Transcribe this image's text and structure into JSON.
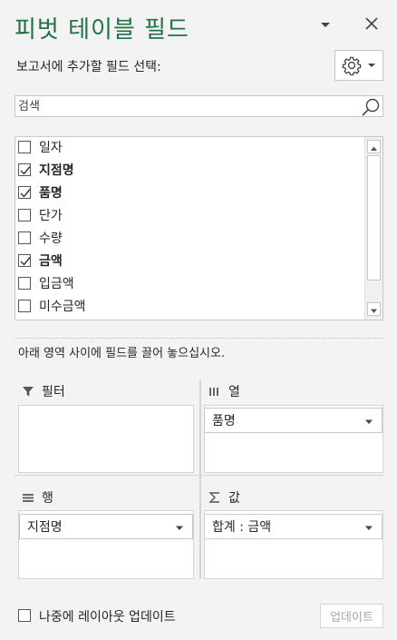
{
  "pane": {
    "title": "피벗 테이블 필드",
    "choose_fields_label": "보고서에 추가할 필드 선택:"
  },
  "search": {
    "placeholder": "검색",
    "value": ""
  },
  "fields": [
    {
      "label": "일자",
      "checked": false
    },
    {
      "label": "지점명",
      "checked": true
    },
    {
      "label": "품명",
      "checked": true
    },
    {
      "label": "단가",
      "checked": false
    },
    {
      "label": "수량",
      "checked": false
    },
    {
      "label": "금액",
      "checked": true
    },
    {
      "label": "입금액",
      "checked": false
    },
    {
      "label": "미수금액",
      "checked": false
    }
  ],
  "drag_instruction": "아래 영역 사이에 필드를 끌어 놓으십시오.",
  "areas": {
    "filters": {
      "label": "필터",
      "icon": "filter-icon"
    },
    "columns": {
      "label": "열",
      "icon": "columns-icon",
      "field": "품명"
    },
    "rows": {
      "label": "행",
      "icon": "rows-icon",
      "field": "지점명"
    },
    "values": {
      "label": "값",
      "icon": "sigma-icon",
      "field": "합계 : 금액"
    }
  },
  "footer": {
    "defer_label": "나중에 레이아웃 업데이트",
    "update_label": "업데이트"
  },
  "colors": {
    "title": "#217346",
    "background": "#f3f3f3",
    "disabled_text": "#a6a6a6"
  }
}
